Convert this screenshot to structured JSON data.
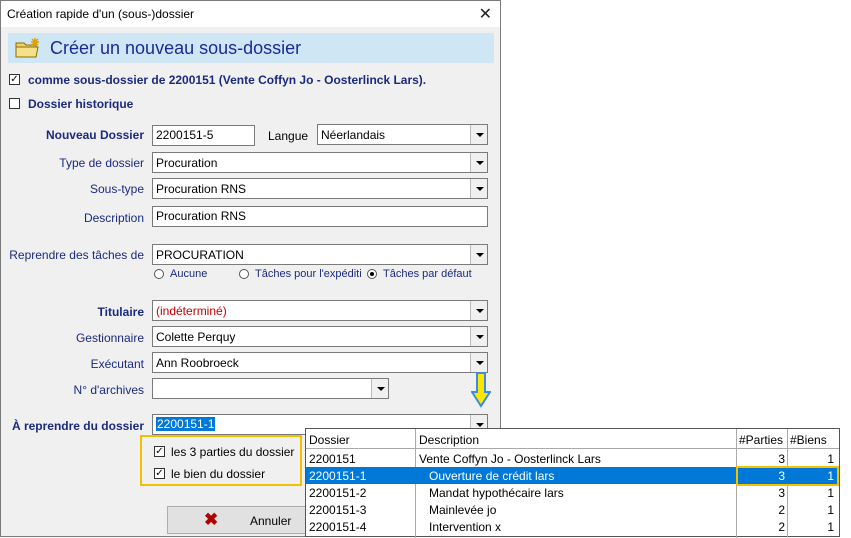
{
  "window": {
    "title": "Création rapide d'un (sous-)dossier",
    "close_glyph": "✕"
  },
  "header": {
    "title": "Créer un nouveau sous-dossier"
  },
  "checks": {
    "subfolder_of": {
      "label": "comme sous-dossier de 2200151 (Vente Coffyn Jo - Oosterlinck Lars).",
      "checked": true
    },
    "historic": {
      "label": "Dossier historique",
      "checked": false
    }
  },
  "form": {
    "nouveau_dossier": {
      "label": "Nouveau Dossier",
      "value": "2200151-5"
    },
    "langue": {
      "label": "Langue",
      "value": "Néerlandais"
    },
    "type_dossier": {
      "label": "Type de dossier",
      "value": "Procuration"
    },
    "sous_type": {
      "label": "Sous-type",
      "value": "Procuration RNS"
    },
    "description": {
      "label": "Description",
      "value": "Procuration RNS"
    },
    "reprendre_taches": {
      "label": "Reprendre des tâches de",
      "value": "PROCURATION"
    },
    "radio": {
      "aucune": "Aucune",
      "expedition": "Tâches pour l'expéditi",
      "defaut": "Tâches par défaut",
      "selected": "defaut"
    },
    "titulaire": {
      "label": "Titulaire",
      "value": "(indéterminé)"
    },
    "gestionnaire": {
      "label": "Gestionnaire",
      "value": "Colette Perquy"
    },
    "executant": {
      "label": "Exécutant",
      "value": "Ann Roobroeck"
    },
    "archives": {
      "label": "N° d'archives",
      "value": ""
    },
    "reprendre_dossier": {
      "label": "À reprendre du dossier",
      "value": "2200151-1"
    }
  },
  "copy_options": {
    "parties": {
      "label": "les 3 parties du dossier",
      "checked": true
    },
    "bien": {
      "label": "le bien du dossier",
      "checked": true
    }
  },
  "buttons": {
    "cancel": "Annuler"
  },
  "dropdown_grid": {
    "columns": [
      "Dossier",
      "Description",
      "#Parties",
      "#Biens"
    ],
    "rows": [
      {
        "dossier": "2200151",
        "description": "Vente Coffyn Jo - Oosterlinck Lars",
        "parties": "3",
        "biens": "1",
        "selected": false
      },
      {
        "dossier": "2200151-1",
        "description": "Ouverture de crédit  lars",
        "parties": "3",
        "biens": "1",
        "selected": true
      },
      {
        "dossier": "2200151-2",
        "description": "Mandat hypothécaire  lars",
        "parties": "3",
        "biens": "1",
        "selected": false
      },
      {
        "dossier": "2200151-3",
        "description": "Mainlevée jo",
        "parties": "2",
        "biens": "1",
        "selected": false
      },
      {
        "dossier": "2200151-4",
        "description": "Intervention x",
        "parties": "2",
        "biens": "1",
        "selected": false
      }
    ]
  },
  "colors": {
    "accent_highlight": "#f5c000",
    "selection": "#0078d7",
    "label_blue": "#1a2a80",
    "undetermined_red": "#c00000"
  }
}
